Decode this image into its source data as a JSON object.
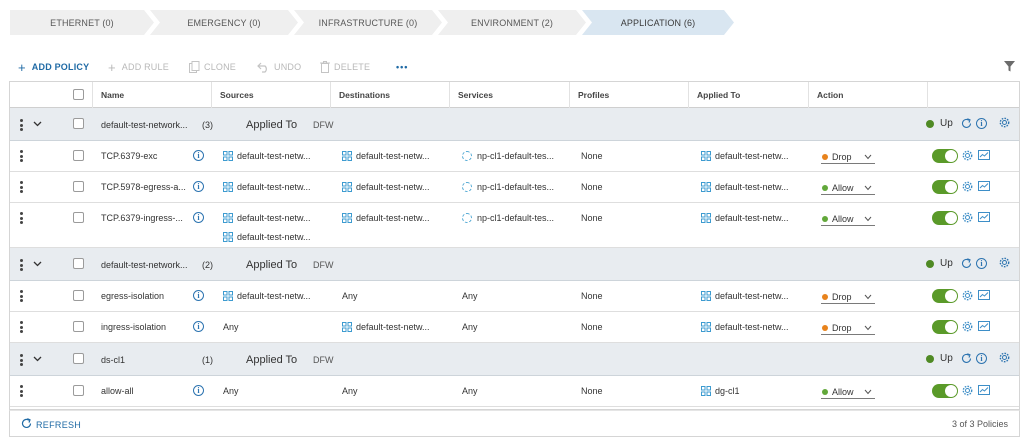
{
  "tabs": [
    {
      "label": "ETHERNET (0)"
    },
    {
      "label": "EMERGENCY (0)"
    },
    {
      "label": "INFRASTRUCTURE (0)"
    },
    {
      "label": "ENVIRONMENT (2)"
    },
    {
      "label": "APPLICATION (6)"
    }
  ],
  "toolbar": {
    "add_policy": "ADD POLICY",
    "add_rule": "ADD RULE",
    "clone": "CLONE",
    "undo": "UNDO",
    "delete": "DELETE",
    "more": "•••"
  },
  "columns": [
    "Name",
    "Sources",
    "Destinations",
    "Services",
    "Profiles",
    "Applied To",
    "Action"
  ],
  "sections": [
    {
      "name": "default-test-network...",
      "count": "(3)",
      "applied_to_label": "Applied To",
      "applied_to_value": "DFW",
      "status": "Up",
      "rules": [
        {
          "name": "TCP.6379-exc",
          "sources": [
            "default-test-netw..."
          ],
          "destinations": [
            "default-test-netw..."
          ],
          "services": [
            "np-cl1-default-tes..."
          ],
          "profiles": "None",
          "applied_to": "default-test-netw...",
          "action": "Drop",
          "action_color": "#e8831c"
        },
        {
          "name": "TCP.5978-egress-a...",
          "sources": [
            "default-test-netw..."
          ],
          "destinations": [
            "default-test-netw..."
          ],
          "services": [
            "np-cl1-default-tes..."
          ],
          "profiles": "None",
          "applied_to": "default-test-netw...",
          "action": "Allow",
          "action_color": "#62a83a"
        },
        {
          "name": "TCP.6379-ingress-...",
          "sources": [
            "default-test-netw...",
            "default-test-netw..."
          ],
          "destinations": [
            "default-test-netw..."
          ],
          "services": [
            "np-cl1-default-tes..."
          ],
          "profiles": "None",
          "applied_to": "default-test-netw...",
          "action": "Allow",
          "action_color": "#62a83a"
        }
      ]
    },
    {
      "name": "default-test-network...",
      "count": "(2)",
      "applied_to_label": "Applied To",
      "applied_to_value": "DFW",
      "status": "Up",
      "rules": [
        {
          "name": "egress-isolation",
          "sources": [
            "default-test-netw..."
          ],
          "destinations": [
            "Any"
          ],
          "services": [
            "Any"
          ],
          "profiles": "None",
          "applied_to": "default-test-netw...",
          "action": "Drop",
          "action_color": "#e8831c"
        },
        {
          "name": "ingress-isolation",
          "sources": [
            "Any"
          ],
          "destinations": [
            "default-test-netw..."
          ],
          "services": [
            "Any"
          ],
          "profiles": "None",
          "applied_to": "default-test-netw...",
          "action": "Drop",
          "action_color": "#e8831c"
        }
      ]
    },
    {
      "name": "ds-cl1",
      "count": "(1)",
      "applied_to_label": "Applied To",
      "applied_to_value": "DFW",
      "status": "Up",
      "rules": [
        {
          "name": "allow-all",
          "sources": [
            "Any"
          ],
          "destinations": [
            "Any"
          ],
          "services": [
            "Any"
          ],
          "profiles": "None",
          "applied_to": "dg-cl1",
          "action": "Allow",
          "action_color": "#62a83a"
        }
      ]
    }
  ],
  "footer": {
    "refresh": "REFRESH",
    "count": "3 of 3 Policies"
  }
}
